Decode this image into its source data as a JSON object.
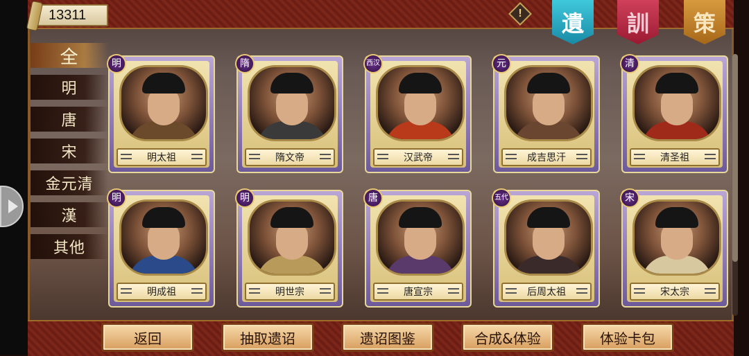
{
  "currency": {
    "amount": "13311"
  },
  "topbar": {
    "info_symbol": "!",
    "banners": [
      {
        "label": "遺",
        "color": "#2fb6cc"
      },
      {
        "label": "訓",
        "color": "#b82a46"
      },
      {
        "label": "策",
        "color": "#c07e2a"
      }
    ]
  },
  "filters": [
    {
      "label": "全",
      "active": true
    },
    {
      "label": "明",
      "active": false
    },
    {
      "label": "唐",
      "active": false
    },
    {
      "label": "宋",
      "active": false
    },
    {
      "label": "金元清",
      "active": false
    },
    {
      "label": "漢",
      "active": false
    },
    {
      "label": "其他",
      "active": false
    }
  ],
  "cards": [
    {
      "dynasty": "明",
      "name": "明太祖",
      "robe": "#6a4a2a"
    },
    {
      "dynasty": "隋",
      "name": "隋文帝",
      "robe": "#3a3a3a"
    },
    {
      "dynasty": "西汉",
      "name": "汉武帝",
      "robe": "#b83a1a"
    },
    {
      "dynasty": "元",
      "name": "成吉思汗",
      "robe": "#6a4630"
    },
    {
      "dynasty": "清",
      "name": "清圣祖",
      "robe": "#a02a1a"
    },
    {
      "dynasty": "明",
      "name": "明成祖",
      "robe": "#2a4a8a"
    },
    {
      "dynasty": "明",
      "name": "明世宗",
      "robe": "#b89a5a"
    },
    {
      "dynasty": "唐",
      "name": "唐宣宗",
      "robe": "#5a3a6a"
    },
    {
      "dynasty": "五代",
      "name": "后周太祖",
      "robe": "#3a2a2a"
    },
    {
      "dynasty": "宋",
      "name": "宋太宗",
      "robe": "#d8c8a0"
    }
  ],
  "buttons": [
    {
      "label": "返回"
    },
    {
      "label": "抽取遗诏"
    },
    {
      "label": "遗诏图鉴"
    },
    {
      "label": "合成&体验"
    },
    {
      "label": "体验卡包"
    }
  ]
}
